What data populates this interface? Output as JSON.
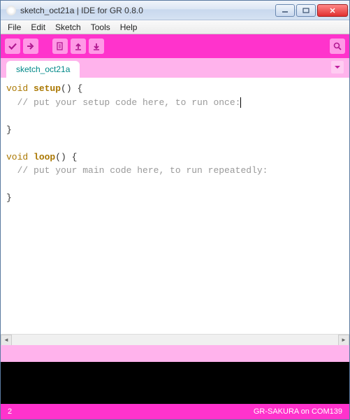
{
  "window": {
    "title": "sketch_oct21a | IDE for GR 0.8.0"
  },
  "menu": {
    "items": [
      "File",
      "Edit",
      "Sketch",
      "Tools",
      "Help"
    ]
  },
  "tabs": {
    "active": "sketch_oct21a"
  },
  "code": {
    "l1_kw": "void",
    "l1_fn": "setup",
    "l1_rest": "() {",
    "l2_cm": "// put your setup code here, to run once:",
    "l4": "}",
    "l6_kw": "void",
    "l6_fn": "loop",
    "l6_rest": "() {",
    "l7_cm": "// put your main code here, to run repeatedly:",
    "l9": "}"
  },
  "status": {
    "line": "2",
    "board": "GR-SAKURA on COM139"
  }
}
